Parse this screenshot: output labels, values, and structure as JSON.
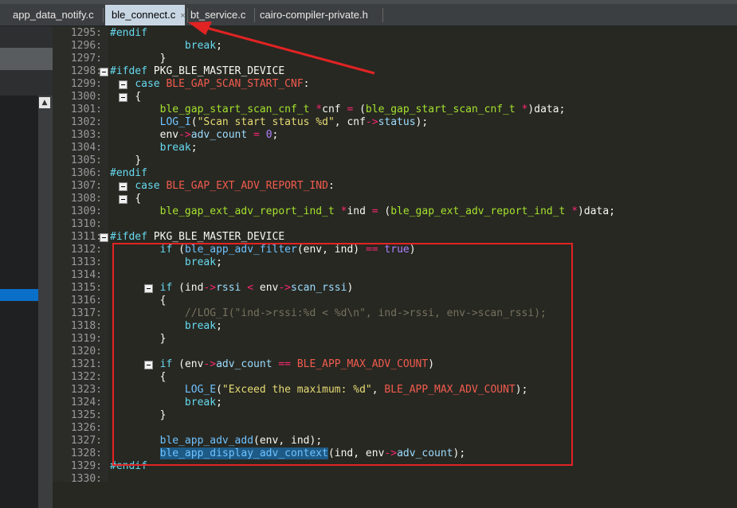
{
  "tabs": [
    {
      "label": "app_data_notify.c",
      "active": false
    },
    {
      "label": "ble_connect.c",
      "active": true
    },
    {
      "label": "bt_service.c",
      "active": false
    },
    {
      "label": "cairo-compiler-private.h",
      "active": false
    }
  ],
  "close_glyph": "×",
  "leftpane": {
    "scroll_up": "▲"
  },
  "code_lines": [
    {
      "n": "1295:",
      "t": "#endif"
    },
    {
      "n": "1296:",
      "t": "            break;"
    },
    {
      "n": "1297:",
      "t": "        }"
    },
    {
      "n": "1298:",
      "t": "#ifdef PKG_BLE_MASTER_DEVICE"
    },
    {
      "n": "1299:",
      "t": "    case BLE_GAP_SCAN_START_CNF:"
    },
    {
      "n": "1300:",
      "t": "    {"
    },
    {
      "n": "1301:",
      "t": "        ble_gap_start_scan_cnf_t *cnf = (ble_gap_start_scan_cnf_t *)data;"
    },
    {
      "n": "1302:",
      "t": "        LOG_I(\"Scan start status %d\", cnf->status);"
    },
    {
      "n": "1303:",
      "t": "        env->adv_count = 0;"
    },
    {
      "n": "1304:",
      "t": "        break;"
    },
    {
      "n": "1305:",
      "t": "    }"
    },
    {
      "n": "1306:",
      "t": "#endif"
    },
    {
      "n": "1307:",
      "t": "    case BLE_GAP_EXT_ADV_REPORT_IND:"
    },
    {
      "n": "1308:",
      "t": "    {"
    },
    {
      "n": "1309:",
      "t": "        ble_gap_ext_adv_report_ind_t *ind = (ble_gap_ext_adv_report_ind_t *)data;"
    },
    {
      "n": "1310:",
      "t": ""
    },
    {
      "n": "1311:",
      "t": "#ifdef PKG_BLE_MASTER_DEVICE"
    },
    {
      "n": "1312:",
      "t": "        if (ble_app_adv_filter(env, ind) == true)"
    },
    {
      "n": "1313:",
      "t": "            break;"
    },
    {
      "n": "1314:",
      "t": ""
    },
    {
      "n": "1315:",
      "t": "        if (ind->rssi < env->scan_rssi)"
    },
    {
      "n": "1316:",
      "t": "        {"
    },
    {
      "n": "1317:",
      "t": "            //LOG_I(\"ind->rssi:%d < %d\\n\", ind->rssi, env->scan_rssi);"
    },
    {
      "n": "1318:",
      "t": "            break;"
    },
    {
      "n": "1319:",
      "t": "        }"
    },
    {
      "n": "1320:",
      "t": ""
    },
    {
      "n": "1321:",
      "t": "        if (env->adv_count == BLE_APP_MAX_ADV_COUNT)"
    },
    {
      "n": "1322:",
      "t": "        {"
    },
    {
      "n": "1323:",
      "t": "            LOG_E(\"Exceed the maximum: %d\", BLE_APP_MAX_ADV_COUNT);"
    },
    {
      "n": "1324:",
      "t": "            break;"
    },
    {
      "n": "1325:",
      "t": "        }"
    },
    {
      "n": "1326:",
      "t": ""
    },
    {
      "n": "1327:",
      "t": "        ble_app_adv_add(env, ind);"
    },
    {
      "n": "1328:",
      "t": "        ble_app_display_adv_context(ind, env->adv_count);"
    },
    {
      "n": "1329:",
      "t": "#endif"
    },
    {
      "n": "1330:",
      "t": ""
    }
  ],
  "colors": {
    "annotation_red": "#e12323",
    "selection": "#1d5a86",
    "active_tab": "#c8d6e4"
  }
}
